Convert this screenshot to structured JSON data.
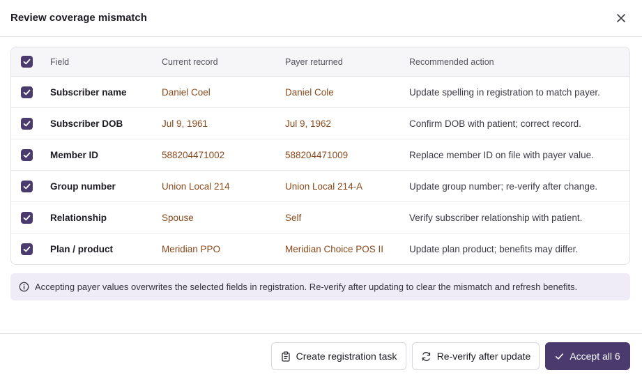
{
  "dialog": {
    "title": "Review coverage mismatch"
  },
  "table": {
    "columns": [
      "Field",
      "Current record",
      "Payer returned",
      "Recommended action"
    ],
    "rows": [
      {
        "checked": true,
        "field": "Subscriber name",
        "current": "Daniel Coel",
        "payer": "Daniel Cole",
        "action": "Update spelling in registration to match payer."
      },
      {
        "checked": true,
        "field": "Subscriber DOB",
        "current": "Jul 9, 1961",
        "payer": "Jul 9, 1962",
        "action": "Confirm DOB with patient; correct record."
      },
      {
        "checked": true,
        "field": "Member ID",
        "current": "588204471002",
        "payer": "588204471009",
        "action": "Replace member ID on file with payer value."
      },
      {
        "checked": true,
        "field": "Group number",
        "current": "Union Local 214",
        "payer": "Union Local 214-A",
        "action": "Update group number; re-verify after change."
      },
      {
        "checked": true,
        "field": "Relationship",
        "current": "Spouse",
        "payer": "Self",
        "action": "Verify subscriber relationship with patient."
      },
      {
        "checked": true,
        "field": "Plan / product",
        "current": "Meridian PPO",
        "payer": "Meridian Choice POS II",
        "action": "Update plan product; benefits may differ."
      }
    ]
  },
  "banner": {
    "icon": "info-icon",
    "text": "Accepting payer values overwrites the selected fields in registration. Re-verify after updating to clear the mismatch and refresh benefits."
  },
  "footer": {
    "create_task_label": "Create registration task",
    "reverify_label": "Re-verify after update",
    "accept_label": "Accept all 6"
  },
  "colors": {
    "accent": "#4a3a6e",
    "value_text": "#8a4a1c",
    "banner_bg": "#efecf8"
  }
}
